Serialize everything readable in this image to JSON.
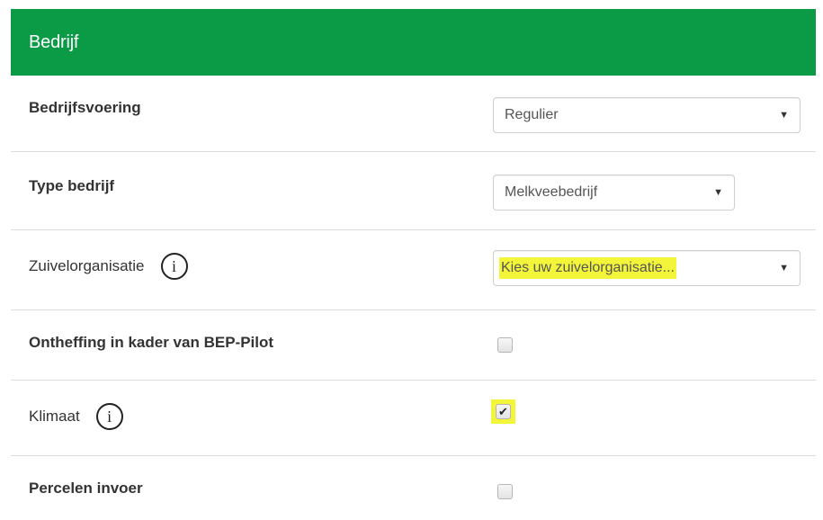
{
  "panel": {
    "title": "Bedrijf"
  },
  "rows": {
    "bedrijfsvoering": {
      "label": "Bedrijfsvoering",
      "value": "Regulier"
    },
    "type_bedrijf": {
      "label": "Type bedrijf",
      "value": "Melkveebedrijf"
    },
    "zuivelorganisatie": {
      "label": "Zuivelorganisatie",
      "value": "Kies uw zuivelorganisatie..."
    },
    "ontheffing": {
      "label": "Ontheffing in kader van BEP-Pilot",
      "checked": false
    },
    "klimaat": {
      "label": "Klimaat",
      "checked": true
    },
    "percelen": {
      "label": "Percelen invoer",
      "checked": false
    }
  },
  "icons": {
    "info": "i",
    "arrow": "▼",
    "check": "✔"
  },
  "colors": {
    "header": "#0b9a45",
    "highlight": "#f3f53a"
  }
}
